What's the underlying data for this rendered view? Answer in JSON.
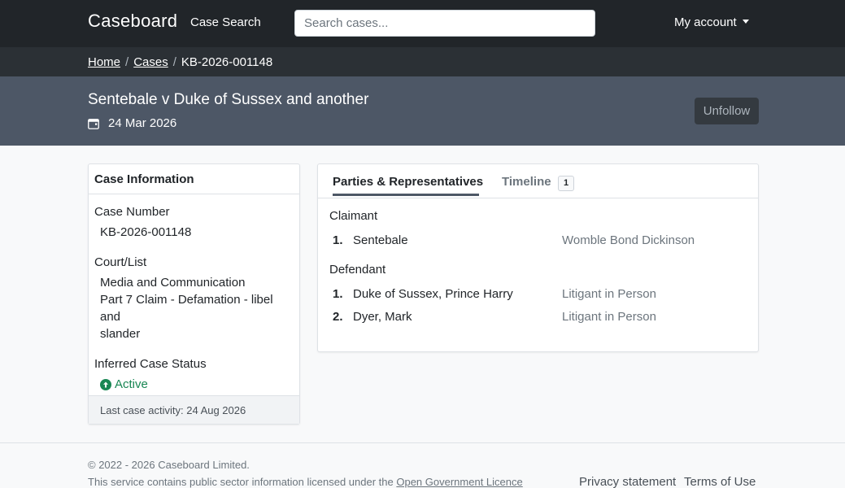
{
  "navbar": {
    "brand": "Caseboard",
    "case_search": "Case Search",
    "search_placeholder": "Search cases...",
    "account": "My account"
  },
  "breadcrumb": {
    "home": "Home",
    "cases": "Cases",
    "current": "KB-2026-001148"
  },
  "case": {
    "title": "Sentebale v Duke of Sussex and another",
    "date": "24 Mar 2026",
    "unfollow_label": "Unfollow"
  },
  "case_info": {
    "heading": "Case Information",
    "case_number_label": "Case Number",
    "case_number": "KB-2026-001148",
    "court_label": "Court/List",
    "court_line1": "Media and Communication",
    "court_line2": "Part 7 Claim - Defamation - libel and",
    "court_line3": "slander",
    "status_label": "Inferred Case Status",
    "status": "Active",
    "status_color": "#198754",
    "last_activity": "Last case activity: 24 Aug 2026"
  },
  "tabs": {
    "parties": "Parties & Representatives",
    "timeline": "Timeline",
    "timeline_count": "1"
  },
  "parties": {
    "claimant_label": "Claimant",
    "claimants": [
      {
        "num": "1.",
        "name": "Sentebale",
        "rep": "Womble Bond Dickinson"
      }
    ],
    "defendant_label": "Defendant",
    "defendants": [
      {
        "num": "1.",
        "name": "Duke of Sussex, Prince Harry",
        "rep": "Litigant in Person"
      },
      {
        "num": "2.",
        "name": "Dyer, Mark",
        "rep": "Litigant in Person"
      }
    ]
  },
  "footer": {
    "copyright": "© 2022 - 2026 Caseboard Limited.",
    "licence_prefix": "This service contains public sector information licensed under the ",
    "licence_link": "Open Government Licence",
    "privacy": "Privacy statement",
    "terms": "Terms of Use"
  }
}
